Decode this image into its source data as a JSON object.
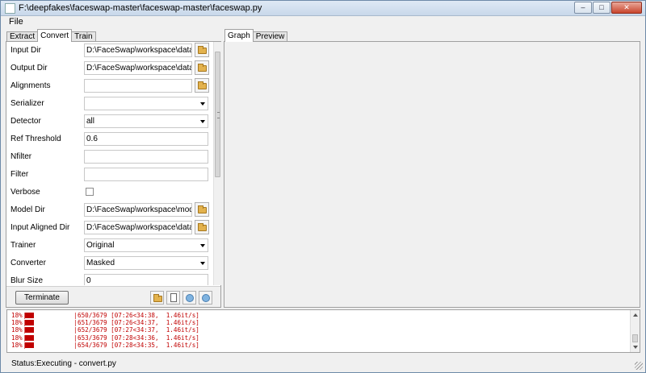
{
  "window": {
    "title": "F:\\deepfakes\\faceswap-master\\faceswap-master\\faceswap.py",
    "minimize": "–",
    "maximize": "□",
    "close": "✕"
  },
  "menu": {
    "file": "File"
  },
  "left_tabs": [
    "Extract",
    "Convert",
    "Train"
  ],
  "right_tabs": [
    "Graph",
    "Preview"
  ],
  "form": {
    "input_dir": {
      "label": "Input Dir",
      "value": "D:\\FaceSwap\\workspace\\data_dst"
    },
    "output_dir": {
      "label": "Output Dir",
      "value": "D:\\FaceSwap\\workspace\\data_dst"
    },
    "alignments": {
      "label": "Alignments",
      "value": ""
    },
    "serializer": {
      "label": "Serializer",
      "value": ""
    },
    "detector": {
      "label": "Detector",
      "value": "all"
    },
    "ref_threshold": {
      "label": "Ref Threshold",
      "value": "0.6"
    },
    "nfilter": {
      "label": "Nfilter",
      "value": ""
    },
    "filter": {
      "label": "Filter",
      "value": ""
    },
    "verbose": {
      "label": "Verbose",
      "checked": false
    },
    "model_dir": {
      "label": "Model Dir",
      "value": "D:\\FaceSwap\\workspace\\model"
    },
    "input_aligned_dir": {
      "label": "Input Aligned Dir",
      "value": "D:\\FaceSwap\\workspace\\data_dst"
    },
    "trainer": {
      "label": "Trainer",
      "value": "Original"
    },
    "converter": {
      "label": "Converter",
      "value": "Masked"
    },
    "blur_size": {
      "label": "Blur Size",
      "value": "0"
    }
  },
  "actions": {
    "terminate": "Terminate"
  },
  "console": {
    "lines": [
      {
        "pct": "18%",
        "progress": 0.18,
        "rest": "650/3679 [07:26<34:38,  1.46it/s]"
      },
      {
        "pct": "18%",
        "progress": 0.18,
        "rest": "651/3679 [07:26<34:37,  1.46it/s]"
      },
      {
        "pct": "18%",
        "progress": 0.18,
        "rest": "652/3679 [07:27<34:37,  1.46it/s]"
      },
      {
        "pct": "18%",
        "progress": 0.18,
        "rest": "653/3679 [07:28<34:36,  1.46it/s]"
      },
      {
        "pct": "18%",
        "progress": 0.18,
        "rest": "654/3679 [07:28<34:35,  1.46it/s]"
      }
    ]
  },
  "status": {
    "label": "Status:",
    "value": "Executing - convert.py"
  },
  "colors": {
    "console_text": "#c00000",
    "folder": "#e3b24d",
    "accent_circle": "#7fb3e0"
  }
}
